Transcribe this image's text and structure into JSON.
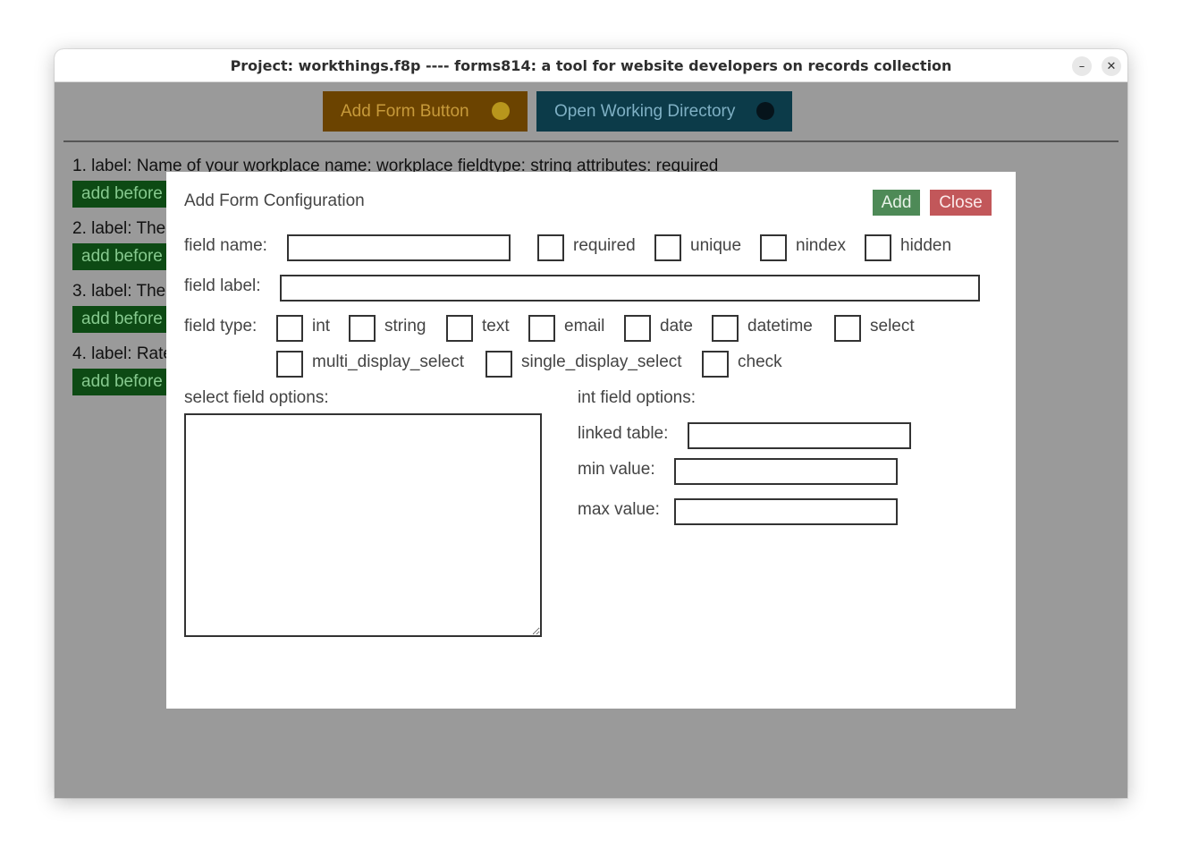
{
  "window": {
    "title": "Project: workthings.f8p ---- forms814: a tool for website developers on records collection",
    "minimize_glyph": "–",
    "close_glyph": "✕"
  },
  "toolbar": {
    "add_form_button": "Add Form Button",
    "open_working_directory": "Open Working Directory"
  },
  "form_list": {
    "items": [
      {
        "label": "1. label: Name of your workplace name: workplace fieldtype: string attributes: required",
        "add_before": "add before"
      },
      {
        "label": "2. label: The",
        "add_before": "add before"
      },
      {
        "label": "3. label: The",
        "add_before": "add before"
      },
      {
        "label": "4. label: Rate",
        "add_before": "add before"
      }
    ]
  },
  "modal": {
    "title": "Add Form Configuration",
    "add_button": "Add",
    "close_button": "Close",
    "field_name_label": "field name:",
    "field_name_value": "",
    "attributes": [
      "required",
      "unique",
      "nindex",
      "hidden"
    ],
    "field_label_label": "field label:",
    "field_label_value": "",
    "field_type_label": "field type:",
    "field_types_row1": [
      "int",
      "string",
      "text",
      "email",
      "date",
      "datetime",
      "select"
    ],
    "field_types_row2": [
      "multi_display_select",
      "single_display_select",
      "check"
    ],
    "select_options_label": "select field options:",
    "select_options_value": "",
    "int_options_label": "int field options:",
    "linked_table_label": "linked table:",
    "linked_table_value": "",
    "min_value_label": "min value:",
    "min_value_value": "",
    "max_value_label": "max value:",
    "max_value_value": ""
  }
}
